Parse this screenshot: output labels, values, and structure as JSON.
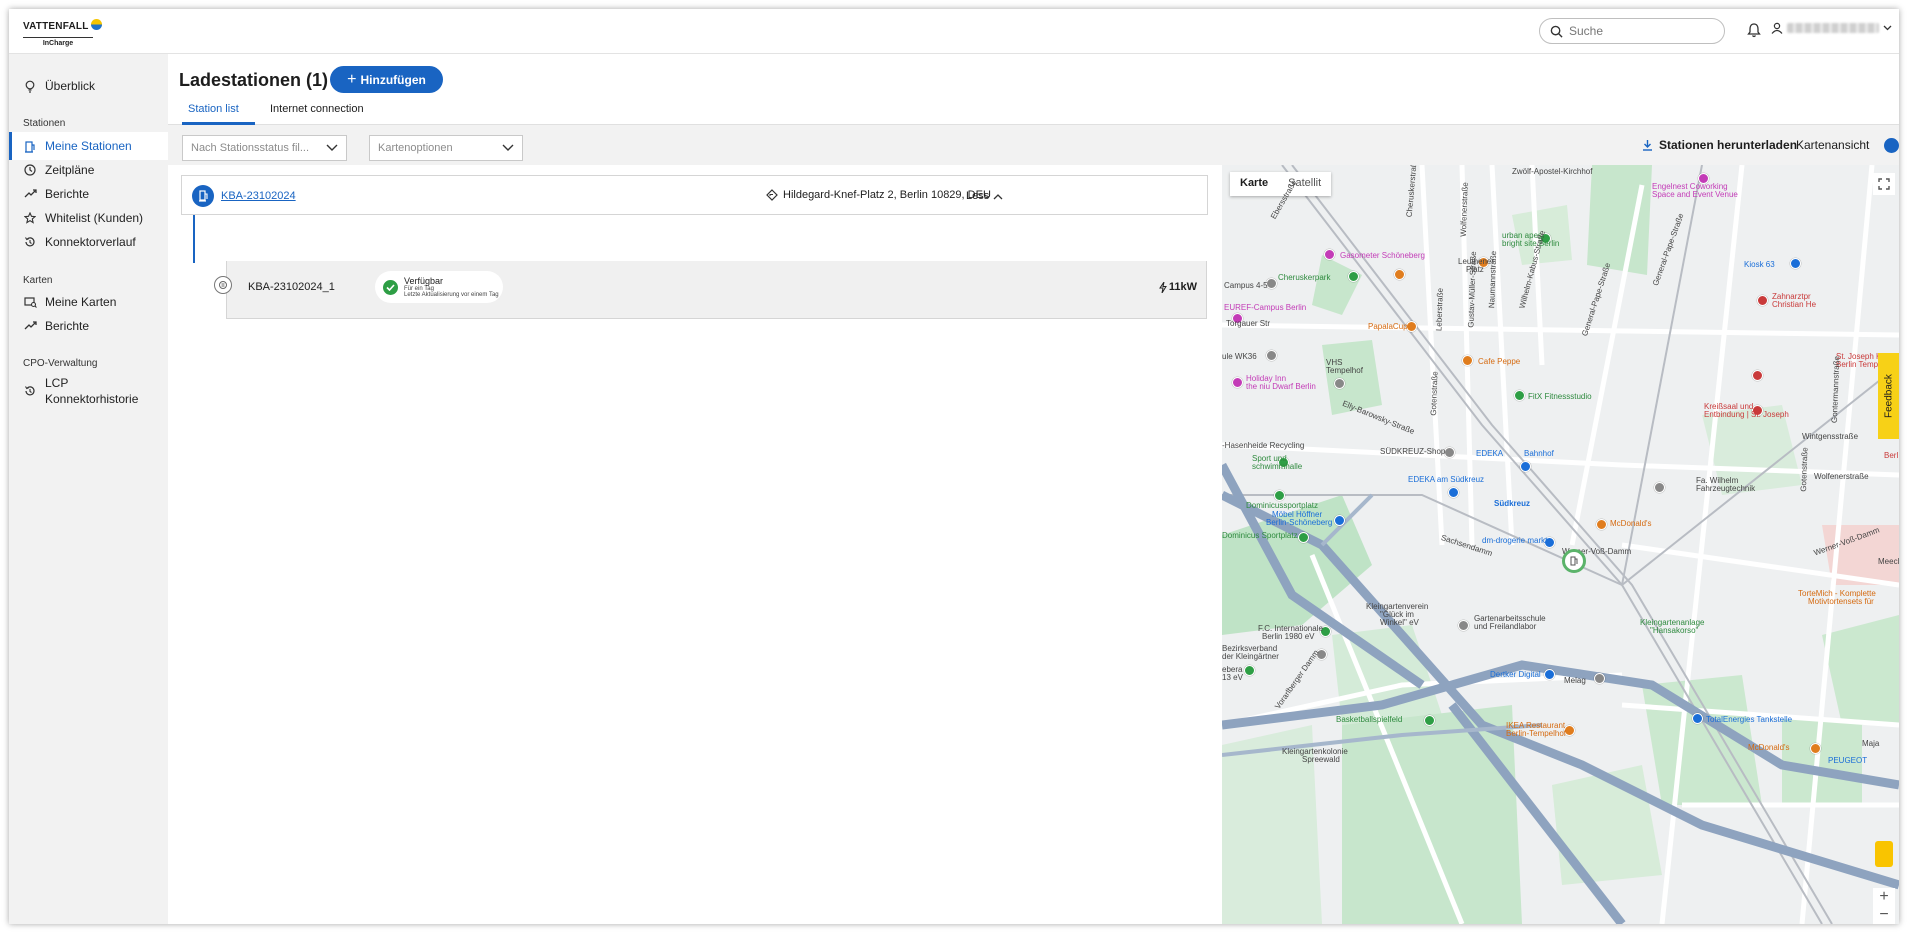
{
  "header": {
    "brand": "VATTENFALL",
    "product": "InCharge",
    "search_placeholder": "Suche"
  },
  "sidebar": {
    "items": [
      {
        "label": "Überblick"
      },
      {
        "section": "Stationen"
      },
      {
        "label": "Meine Stationen",
        "active": true
      },
      {
        "label": "Zeitpläne"
      },
      {
        "label": "Berichte"
      },
      {
        "label": "Whitelist (Kunden)"
      },
      {
        "label": "Konnektorverlauf"
      },
      {
        "section": "Karten"
      },
      {
        "label": "Meine Karten"
      },
      {
        "label": "Berichte"
      },
      {
        "section": "CPO-Verwaltung"
      },
      {
        "label_line1": "LCP",
        "label_line2": "Konnektorhistorie"
      }
    ]
  },
  "main": {
    "title": "Ladestationen (1)",
    "add_label": "Hinzufügen",
    "tabs": [
      {
        "label": "Station list",
        "active": true
      },
      {
        "label": "Internet connection"
      }
    ],
    "filter_status_placeholder": "Nach Stationsstatus fil...",
    "filter_card_placeholder": "Kartenoptionen",
    "download_label": "Stationen herunterladen",
    "map_view_label": "Kartenansicht"
  },
  "station": {
    "id": "KBA-23102024",
    "address": "Hildegard-Knef-Platz 2, Berlin 10829, DEU",
    "toggle_label": "Less",
    "connector": {
      "id": "KBA-23102024_1",
      "status": "Verfügbar",
      "status_since": "Für ein Tag",
      "last_update": "Letzte Aktualisierung vor einem Tag",
      "power": "11kW"
    }
  },
  "map": {
    "tab_map": "Karte",
    "tab_satellite": "Satellit",
    "labels": {
      "l1": "Zwölf-Apostel-Kirchhof",
      "l2": "Engelnest Coworking",
      "l3": "Space and Event Venue",
      "l4": "urban apes",
      "l5": "bright site Berlin",
      "l6": "Gasometer Schöneberg",
      "l7": "Leuthener",
      "l8": "Platz",
      "l9": "Kiosk 63",
      "l10": "Zahnarztpr",
      "l11": "Christian He",
      "l12": "Campus 4-5",
      "l13": "Cheruskerpark",
      "l14": "EUREF-Campus Berlin",
      "l15": "Torgauer Str",
      "l16": "PapalaCup",
      "l17": "Cafe Peppe",
      "l18": "St. Joseph Kr",
      "l19": "Berlin Tempel",
      "l20": "ule WK36",
      "l21": "VHS",
      "l22": "Tempelhof",
      "l23": "Holiday Inn",
      "l24": "the niu Dwarf Berlin",
      "l25": "FitX Fitnessstudio",
      "l26": "Kreißsaal und",
      "l27": "Entbindung | St. Joseph",
      "l28": "Wintgensstraße",
      "l29": "Elly-Barowsky-Straße",
      "l30": "-Hasenheide Recycling",
      "l31": "Sport und",
      "l32": "schwimmhalle",
      "l33": "SÜDKREUZ-Shop",
      "l34": "EDEKA",
      "l35": "Bahnhof",
      "l36": "EDEKA am Südkreuz",
      "l37": "Fa. Wilhelm",
      "l38": "Fahrzeugtechnik",
      "l39": "Wolfenerstraße",
      "l40": "Dominicussportplatz",
      "l41": "Südkreuz",
      "l42": "Möbel Höffner",
      "l43": "Berlin-Schöneberg",
      "l44": "McDonald's",
      "l45": "Dominicus Sportplatz",
      "l46": "dm-drogerie markt",
      "l47": "Werner-Voß-Damm",
      "l48": "Werner-Voß-Damm",
      "l49": "Sachsendamm",
      "l50": "Meecl",
      "l51": "TorteMich - Komplette",
      "l52": "Motivtortensets für",
      "l53": "Kleingartenverein",
      "l54": "\"Glück im",
      "l55": "Winkel\" eV",
      "l56": "Gartenarbeitsschule",
      "l57": "und Freilandlabor",
      "l58": "Kleingartenanlage",
      "l59": "\"Hansakorso\"",
      "l60": "F.C. Internationale",
      "l61": "Berlin 1980 eV",
      "l62": "Bezirksverband",
      "l63": "der Kleingärtner",
      "l64": "ebera",
      "l65": "13 eV",
      "l66": "Vorarlberger Damm",
      "l67": "Dertker Digital",
      "l68": "Melag",
      "l69": "Basketballspielfeld",
      "l70": "IKEA Restaurant",
      "l71": "Berlin-Tempelhof",
      "l72": "TotalEnergies Tankstelle",
      "l73": "McDonald's",
      "l74": "Kleingartenkolonie",
      "l75": "Spreewald",
      "l76": "General-Pape-Straße",
      "l77": "Wilhelm-Kabus-Straße",
      "l78": "General-Pape-Straße",
      "l79": "Gotenstraße",
      "l80": "Gotenstraße",
      "l81": "Naumannstraße",
      "l82": "Leberstraße",
      "l83": "Gustav-Müller-Straße",
      "l84": "Cheruskerstraße",
      "l85": "Ebersstraße",
      "l86": "Wolfenerstraße",
      "l87": "Gontermannstraße",
      "l88": "PEUGEOT",
      "l89": "Berl",
      "l90": "Maja"
    }
  },
  "feedback_label": "Feedback",
  "colors": {
    "accent": "#1964c2",
    "available": "#2e9e45",
    "feedback": "#f7d117"
  }
}
